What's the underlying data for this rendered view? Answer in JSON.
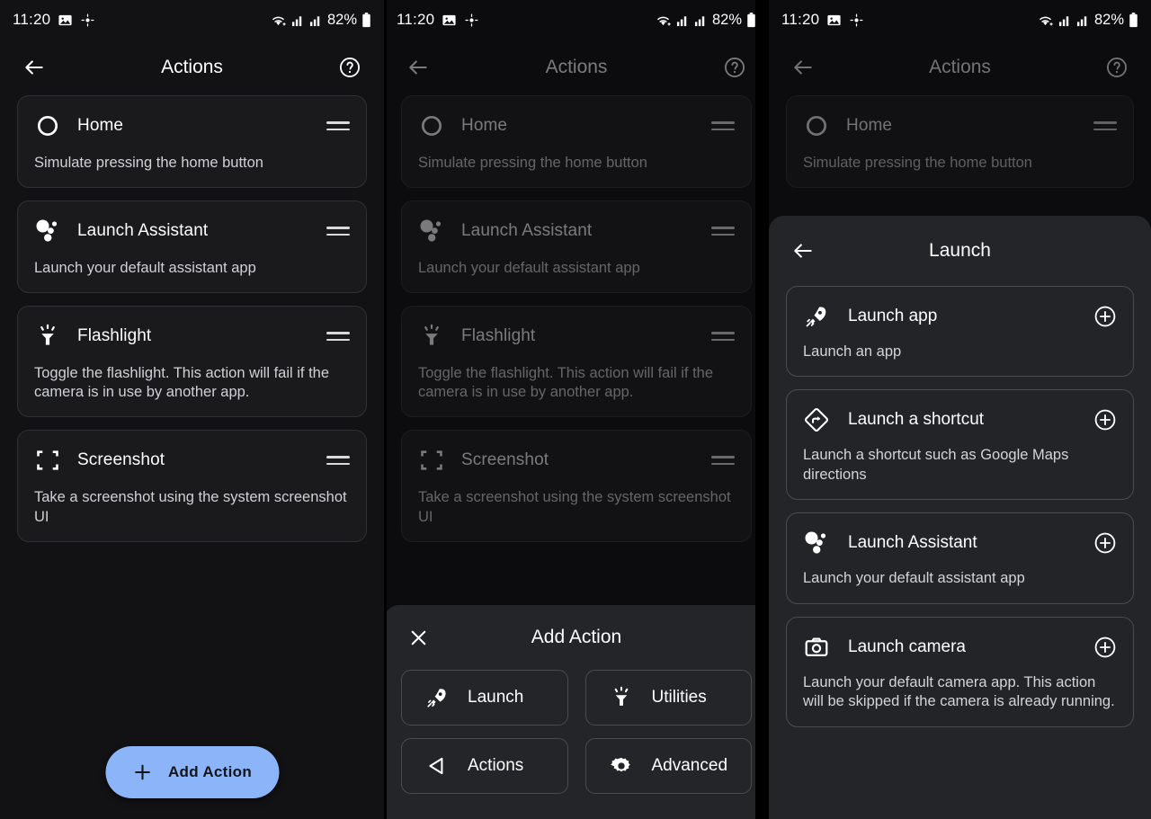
{
  "status_bar": {
    "time": "11:20",
    "battery_percent": "82%",
    "icons": [
      "image-icon",
      "location-icon",
      "wifi-icon",
      "signal-icon",
      "signal-icon",
      "battery-icon"
    ]
  },
  "colors": {
    "page_background": "#121214",
    "card_background": "#1a1a1c",
    "card_border": "#2e3033",
    "sheet_background": "#242528",
    "fab_background": "#8cb4f8",
    "fab_text": "#12151a",
    "primary_text": "#ffffff",
    "secondary_text": "#cfd1d4"
  },
  "panel1": {
    "appbar": {
      "title": "Actions",
      "back": "back-arrow-icon",
      "help": "help-icon"
    },
    "actions": [
      {
        "icon": "home-circle-icon",
        "title": "Home",
        "description": "Simulate pressing the home button",
        "handle": "drag-handle-icon"
      },
      {
        "icon": "assistant-icon",
        "title": "Launch Assistant",
        "description": "Launch your default assistant app",
        "handle": "drag-handle-icon"
      },
      {
        "icon": "flashlight-icon",
        "title": "Flashlight",
        "description": "Toggle the flashlight. This action will fail if the camera is in use by another app.",
        "handle": "drag-handle-icon"
      },
      {
        "icon": "screenshot-icon",
        "title": "Screenshot",
        "description": "Take a screenshot using the system screenshot UI",
        "handle": "drag-handle-icon"
      }
    ],
    "fab": {
      "label": "Add Action",
      "icon": "plus-icon"
    }
  },
  "panel2": {
    "appbar": {
      "title": "Actions",
      "back": "back-arrow-icon",
      "help": "help-icon"
    },
    "actions": [
      {
        "icon": "home-circle-icon",
        "title": "Home",
        "description": "Simulate pressing the home button",
        "handle": "drag-handle-icon"
      },
      {
        "icon": "assistant-icon",
        "title": "Launch Assistant",
        "description": "Launch your default assistant app",
        "handle": "drag-handle-icon"
      },
      {
        "icon": "flashlight-icon",
        "title": "Flashlight",
        "description": "Toggle the flashlight. This action will fail if the camera is in use by another app.",
        "handle": "drag-handle-icon"
      },
      {
        "icon": "screenshot-icon",
        "title": "Screenshot",
        "description": "Take a screenshot using the system screenshot UI",
        "handle": "drag-handle-icon"
      }
    ],
    "sheet": {
      "title": "Add Action",
      "close": "close-icon",
      "categories": [
        {
          "icon": "rocket-icon",
          "label": "Launch"
        },
        {
          "icon": "flashlight-icon",
          "label": "Utilities"
        },
        {
          "icon": "back-triangle-icon",
          "label": "Actions"
        },
        {
          "icon": "gear-icon",
          "label": "Advanced"
        }
      ]
    }
  },
  "panel3": {
    "appbar": {
      "title": "Actions",
      "back": "back-arrow-icon",
      "help": "help-icon"
    },
    "actions": [
      {
        "icon": "home-circle-icon",
        "title": "Home",
        "description": "Simulate pressing the home button",
        "handle": "drag-handle-icon"
      }
    ],
    "sheet": {
      "title": "Launch",
      "back": "back-arrow-icon",
      "items": [
        {
          "icon": "rocket-icon",
          "title": "Launch app",
          "description": "Launch an app",
          "add": "plus-circle-icon"
        },
        {
          "icon": "shortcut-diamond-icon",
          "title": "Launch a shortcut",
          "description": "Launch a shortcut such as Google Maps directions",
          "add": "plus-circle-icon"
        },
        {
          "icon": "assistant-icon",
          "title": "Launch Assistant",
          "description": "Launch your default assistant app",
          "add": "plus-circle-icon"
        },
        {
          "icon": "camera-icon",
          "title": "Launch camera",
          "description": "Launch your default camera app. This action will be skipped if the camera is already running.",
          "add": "plus-circle-icon"
        }
      ]
    }
  }
}
